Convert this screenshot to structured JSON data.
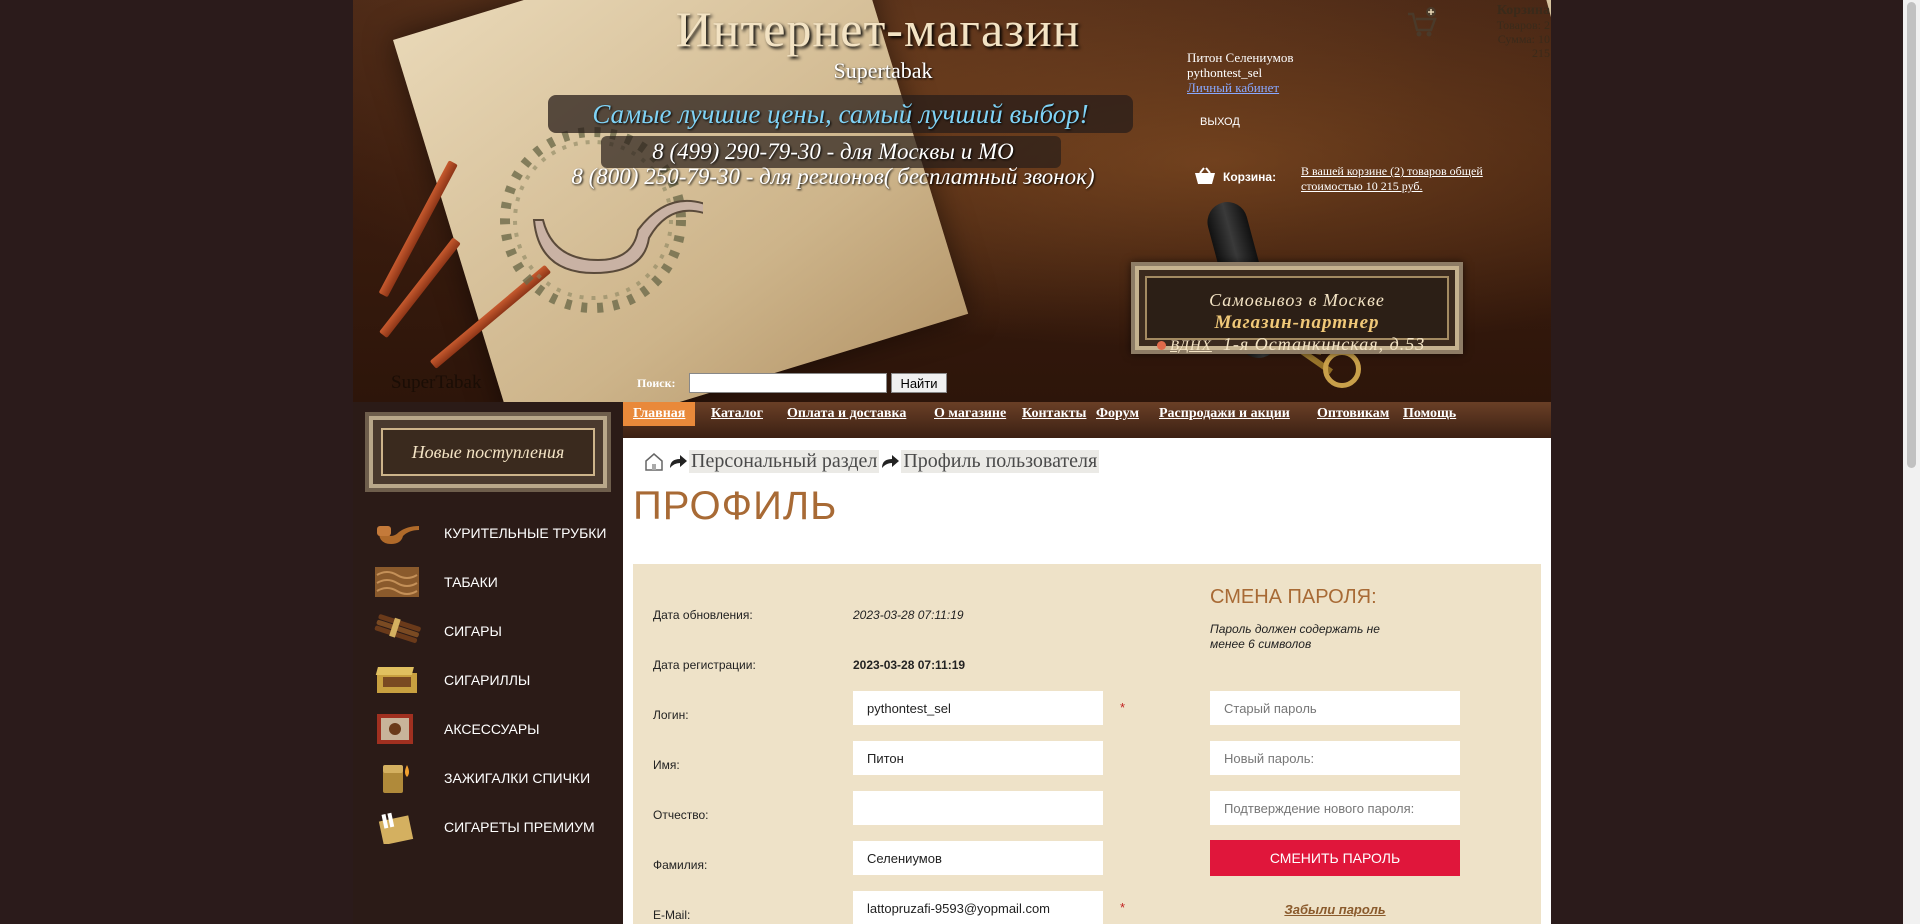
{
  "header": {
    "title": "Интернет-магазин",
    "subtitle": "Supertabak",
    "slogan": "Самые лучшие цены, самый лучший выбор!",
    "phone_moscow": "8 (499) 290-79-30 - для Москвы и МО",
    "phone_regions": "8 (800) 250-79-30 - для регионов( бесплатный звонок)",
    "logo_text": "SuperTabak",
    "search_label": "Поиск:",
    "search_value": "",
    "search_button": "Найти"
  },
  "user": {
    "name": "Питон Селениумов",
    "login": "pythontest_sel",
    "cabinet_link": "Личный кабинет",
    "logout": "ВЫХОД"
  },
  "cart": {
    "title": "Корзина",
    "items": "Товаров: 2",
    "sum": "Сумма: 10",
    "sum_cont": "215",
    "basket_label": "Корзина:",
    "basket_text": "В вашей корзине (2) товаров общей стоимостью 10 215 руб."
  },
  "pickup": {
    "line1": "Самовывоз в Москве",
    "line2": "Магазин-партнер",
    "metro": "ВДНХ",
    "address": "1-я Останкинская, д.53"
  },
  "sidebar": {
    "new_arrivals": "Новые поступления",
    "categories": [
      {
        "label": "КУРИТЕЛЬНЫЕ ТРУБКИ",
        "icon": "pipe-icon"
      },
      {
        "label": "ТАБАКИ",
        "icon": "tobacco-icon"
      },
      {
        "label": "СИГАРЫ",
        "icon": "cigars-icon"
      },
      {
        "label": "СИГАРИЛЛЫ",
        "icon": "cigarillos-icon"
      },
      {
        "label": "АКСЕССУАРЫ",
        "icon": "accessories-icon"
      },
      {
        "label": "ЗАЖИГАЛКИ СПИЧКИ",
        "icon": "lighter-icon"
      },
      {
        "label": "СИГАРЕТЫ ПРЕМИУМ",
        "icon": "cigarettes-icon"
      }
    ]
  },
  "nav": {
    "items": [
      {
        "label": "Главная",
        "active": true
      },
      {
        "label": "Каталог"
      },
      {
        "label": "Оплата и доставка"
      },
      {
        "label": "О магазине"
      },
      {
        "label": "Контакты"
      },
      {
        "label": "Форум"
      },
      {
        "label": "Распродажи и акции"
      },
      {
        "label": "Оптовикам"
      },
      {
        "label": "Помощь"
      }
    ]
  },
  "breadcrumb": {
    "items": [
      "Персональный раздел",
      "Профиль пользователя"
    ]
  },
  "page": {
    "title": "ПРОФИЛЬ"
  },
  "profile": {
    "updated_label": "Дата обновления:",
    "updated_value": "2023-03-28 07:11:19",
    "registered_label": "Дата регистрации:",
    "registered_value": "2023-03-28 07:11:19",
    "login_label": "Логин:",
    "login_value": "pythontest_sel",
    "name_label": "Имя:",
    "name_value": "Питон",
    "patronymic_label": "Отчество:",
    "patronymic_value": "",
    "surname_label": "Фамилия:",
    "surname_value": "Селениумов",
    "email_label": "E-Mail:",
    "email_value": "lattopruzafi-9593@yopmail.com",
    "required_mark": "*"
  },
  "password": {
    "title": "СМЕНА ПАРОЛЯ:",
    "hint": "Пароль должен содержать не менее 6 символов",
    "old_placeholder": "Старый пароль",
    "new_placeholder": "Новый пароль:",
    "confirm_placeholder": "Подтверждение нового пароля:",
    "button": "СМЕНИТЬ ПАРОЛЬ",
    "forgot": "Забыли пароль"
  },
  "colors": {
    "accent": "#a86a35",
    "button_red": "#e0163b",
    "nav_active": "#e9893a",
    "form_bg": "#eee2c8"
  }
}
